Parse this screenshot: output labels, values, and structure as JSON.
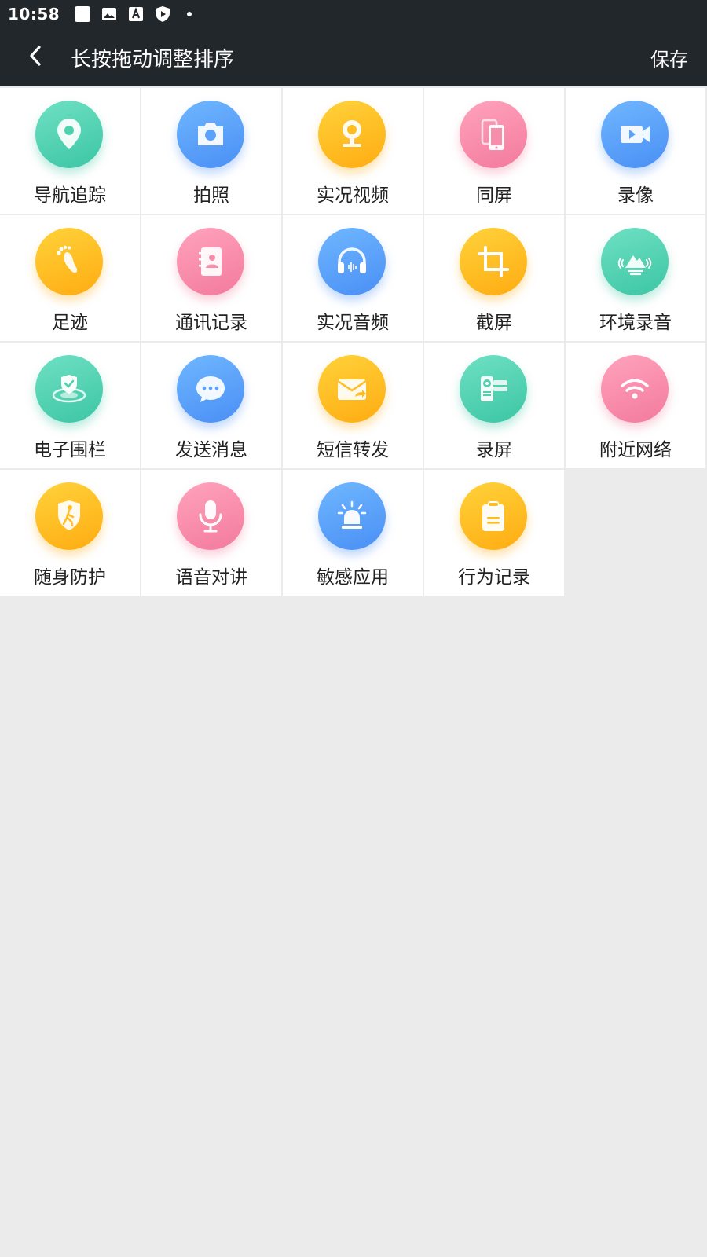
{
  "status_bar": {
    "time": "10:58",
    "icons": [
      "blank-square-icon",
      "image-icon",
      "font-icon",
      "shield-play-icon",
      "dot-icon"
    ]
  },
  "toolbar": {
    "title": "长按拖动调整排序",
    "save_label": "保存",
    "back_icon": "chevron-left-icon"
  },
  "colors": {
    "toolbar_bg": "#22272b",
    "page_bg": "#ebebeb",
    "teal": "#4fd1b0",
    "blue": "#5aa2fb",
    "yellow": "#ffbd22",
    "pink": "#f68dab"
  },
  "features": [
    {
      "label": "导航追踪",
      "icon": "location-pin-icon",
      "color": "teal"
    },
    {
      "label": "拍照",
      "icon": "camera-icon",
      "color": "blue"
    },
    {
      "label": "实况视频",
      "icon": "webcam-icon",
      "color": "yellow"
    },
    {
      "label": "同屏",
      "icon": "phone-mirror-icon",
      "color": "pink"
    },
    {
      "label": "录像",
      "icon": "video-camera-icon",
      "color": "blue"
    },
    {
      "label": "足迹",
      "icon": "footprint-icon",
      "color": "yellow"
    },
    {
      "label": "通讯记录",
      "icon": "contacts-book-icon",
      "color": "pink"
    },
    {
      "label": "实况音频",
      "icon": "headphones-icon",
      "color": "blue"
    },
    {
      "label": "截屏",
      "icon": "crop-icon",
      "color": "yellow"
    },
    {
      "label": "环境录音",
      "icon": "mountain-sound-icon",
      "color": "teal"
    },
    {
      "label": "电子围栏",
      "icon": "shield-fence-icon",
      "color": "teal"
    },
    {
      "label": "发送消息",
      "icon": "chat-bubble-icon",
      "color": "blue"
    },
    {
      "label": "短信转发",
      "icon": "envelope-forward-icon",
      "color": "yellow"
    },
    {
      "label": "录屏",
      "icon": "screen-record-icon",
      "color": "teal"
    },
    {
      "label": "附近网络",
      "icon": "wifi-icon",
      "color": "pink"
    },
    {
      "label": "随身防护",
      "icon": "walking-shield-icon",
      "color": "yellow"
    },
    {
      "label": "语音对讲",
      "icon": "microphone-icon",
      "color": "pink"
    },
    {
      "label": "敏感应用",
      "icon": "alarm-light-icon",
      "color": "blue"
    },
    {
      "label": "行为记录",
      "icon": "clipboard-icon",
      "color": "yellow"
    }
  ]
}
